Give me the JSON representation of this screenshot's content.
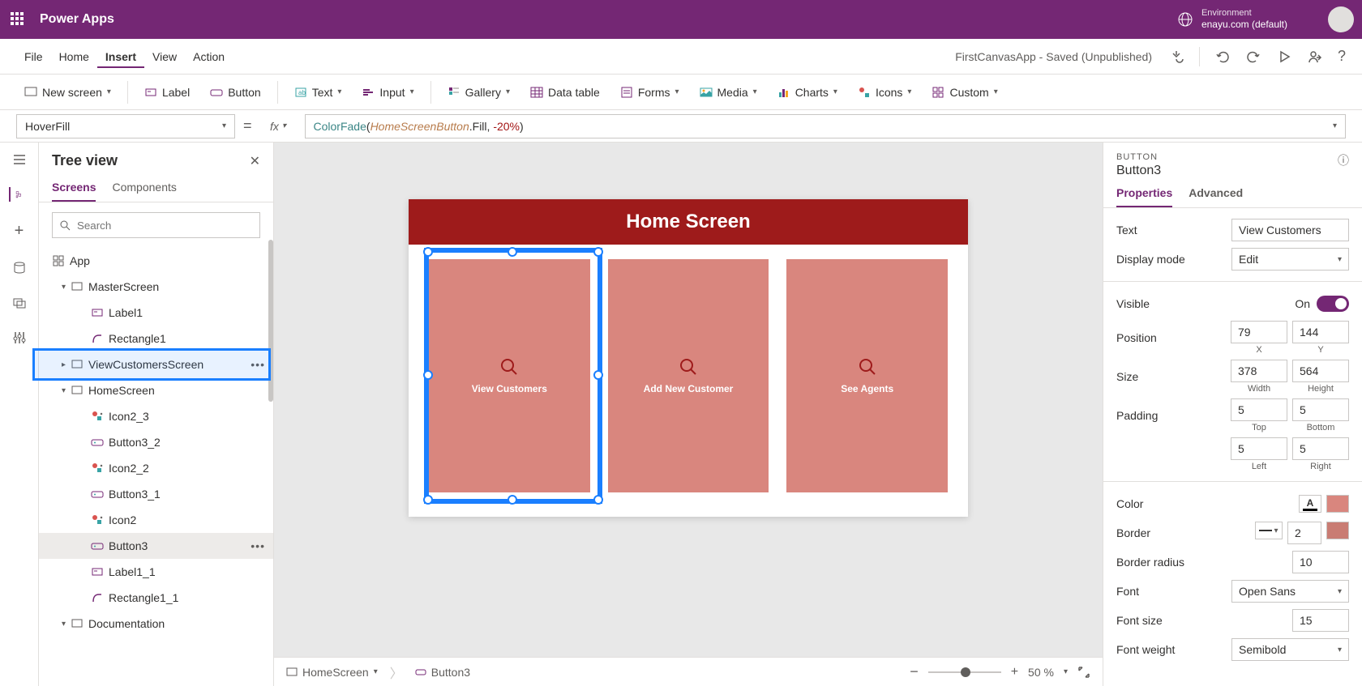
{
  "header": {
    "title": "Power Apps",
    "env_label": "Environment",
    "env_value": "enayu.com (default)"
  },
  "menu": {
    "items": [
      "File",
      "Home",
      "Insert",
      "View",
      "Action"
    ],
    "active": 2,
    "status": "FirstCanvasApp - Saved (Unpublished)"
  },
  "ribbon": {
    "new_screen": "New screen",
    "label": "Label",
    "button": "Button",
    "text": "Text",
    "input": "Input",
    "gallery": "Gallery",
    "datatable": "Data table",
    "forms": "Forms",
    "media": "Media",
    "charts": "Charts",
    "icons": "Icons",
    "custom": "Custom"
  },
  "formula": {
    "property": "HoverFill",
    "tokens": {
      "fn": "ColorFade",
      "id": "HomeScreenButton",
      "prop": ".Fill",
      "sep": ", ",
      "num": "-20%",
      "open": "(",
      "close": ")"
    }
  },
  "tree": {
    "title": "Tree view",
    "tabs": [
      "Screens",
      "Components"
    ],
    "search_ph": "Search",
    "items": [
      {
        "name": "App",
        "ind": 0,
        "icon": "app"
      },
      {
        "name": "MasterScreen",
        "ind": 1,
        "icon": "screen",
        "exp": "down"
      },
      {
        "name": "Label1",
        "ind": 2,
        "icon": "label"
      },
      {
        "name": "Rectangle1",
        "ind": 2,
        "icon": "rect"
      },
      {
        "name": "ViewCustomersScreen",
        "ind": 1,
        "icon": "screen",
        "exp": "right",
        "dots": true,
        "highlight": true
      },
      {
        "name": "HomeScreen",
        "ind": 1,
        "icon": "screen",
        "exp": "down"
      },
      {
        "name": "Icon2_3",
        "ind": 2,
        "icon": "iconctl"
      },
      {
        "name": "Button3_2",
        "ind": 2,
        "icon": "button"
      },
      {
        "name": "Icon2_2",
        "ind": 2,
        "icon": "iconctl"
      },
      {
        "name": "Button3_1",
        "ind": 2,
        "icon": "button"
      },
      {
        "name": "Icon2",
        "ind": 2,
        "icon": "iconctl"
      },
      {
        "name": "Button3",
        "ind": 2,
        "icon": "button",
        "selected": true,
        "dots": true
      },
      {
        "name": "Label1_1",
        "ind": 2,
        "icon": "label"
      },
      {
        "name": "Rectangle1_1",
        "ind": 2,
        "icon": "rect"
      },
      {
        "name": "Documentation",
        "ind": 1,
        "icon": "screen",
        "exp": "down"
      }
    ]
  },
  "canvas": {
    "header": "Home Screen",
    "cards": [
      "View Customers",
      "Add New Customer",
      "See Agents"
    ],
    "breadcrumb": [
      "HomeScreen",
      "Button3"
    ],
    "zoom": "50",
    "zoom_unit": "%"
  },
  "props": {
    "type": "BUTTON",
    "name": "Button3",
    "tabs": [
      "Properties",
      "Advanced"
    ],
    "text_lbl": "Text",
    "text_val": "View Customers",
    "mode_lbl": "Display mode",
    "mode_val": "Edit",
    "visible_lbl": "Visible",
    "visible_val": "On",
    "pos_lbl": "Position",
    "pos_x": "79",
    "pos_y": "144",
    "x_lbl": "X",
    "y_lbl": "Y",
    "size_lbl": "Size",
    "w_val": "378",
    "h_val": "564",
    "w_lbl": "Width",
    "h_lbl": "Height",
    "pad_lbl": "Padding",
    "pad_t": "5",
    "pad_b": "5",
    "pad_l": "5",
    "pad_r": "5",
    "t_lbl": "Top",
    "b_lbl": "Bottom",
    "l_lbl": "Left",
    "r_lbl": "Right",
    "color_lbl": "Color",
    "border_lbl": "Border",
    "border_val": "2",
    "radius_lbl": "Border radius",
    "radius_val": "10",
    "font_lbl": "Font",
    "font_val": "Open Sans",
    "fsize_lbl": "Font size",
    "fsize_val": "15",
    "fweight_lbl": "Font weight",
    "fweight_val": "Semibold"
  }
}
